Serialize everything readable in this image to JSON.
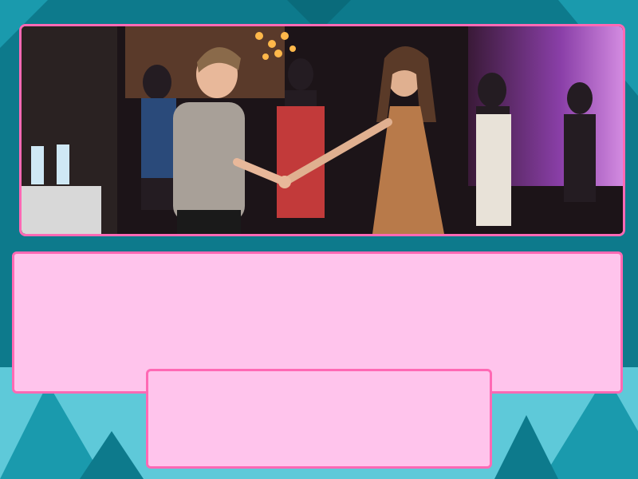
{
  "theme": {
    "background": "#0d7a8c",
    "accent_light": "#5ec9d9",
    "accent_mid": "#1a9aad",
    "panel_fill": "#ffc4ec",
    "panel_border": "#ff69b4"
  },
  "photo": {
    "icon": "photo-dancing-couple"
  },
  "question_box": {
    "text": ""
  },
  "answer_box": {
    "text": ""
  }
}
